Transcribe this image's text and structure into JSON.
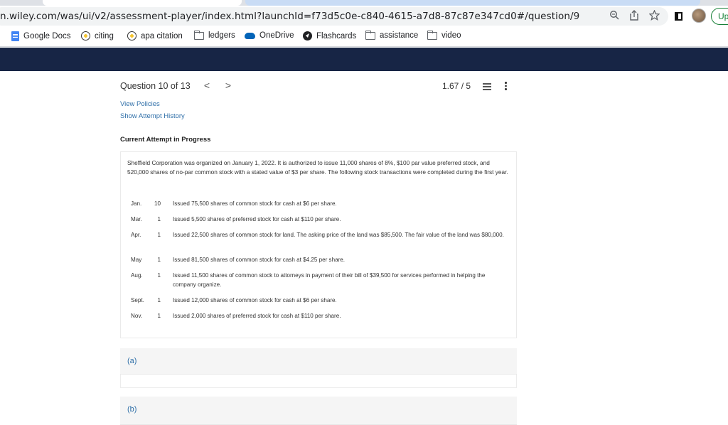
{
  "browser": {
    "url": "n.wiley.com/was/ui/v2/assessment-player/index.html?launchId=f73d5c0e-c840-4615-a7d8-87c87e347cd0#/question/9",
    "update_label": "Up",
    "bookmarks": [
      {
        "label": "Google Docs",
        "icon": "google-docs-icon"
      },
      {
        "label": "citing",
        "icon": "globe-icon"
      },
      {
        "label": "apa citation",
        "icon": "globe-icon"
      },
      {
        "label": "ledgers",
        "icon": "folder-icon"
      },
      {
        "label": "OneDrive",
        "icon": "cloud-icon"
      },
      {
        "label": "Flashcards",
        "icon": "flashcards-icon"
      },
      {
        "label": "assistance",
        "icon": "folder-icon"
      },
      {
        "label": "video",
        "icon": "folder-icon"
      }
    ]
  },
  "header": {
    "question_label": "Question 10 of 13",
    "prev_arrow": "<",
    "next_arrow": ">",
    "score": "1.67 / 5"
  },
  "links": {
    "view_policies": "View Policies",
    "attempt_history": "Show Attempt History"
  },
  "section_title": "Current Attempt in Progress",
  "problem": {
    "intro": "Sheffield Corporation was organized on January 1, 2022. It is authorized to issue 11,000 shares of 8%, $100 par value preferred stock, and 520,000 shares of no-par common stock with a stated value of $3 per share. The following stock transactions were completed during the first year.",
    "transactions": [
      {
        "month": "Jan.",
        "day": "10",
        "desc": "Issued 75,500 shares of common stock for cash at $6 per share."
      },
      {
        "month": "Mar.",
        "day": "1",
        "desc": "Issued 5,500 shares of preferred stock for cash at $110 per share."
      },
      {
        "month": "Apr.",
        "day": "1",
        "desc": "Issued 22,500 shares of common stock for land. The asking price of the land was $85,500. The fair value of the land was $80,000."
      },
      {
        "month": "May",
        "day": "1",
        "desc": "Issued 81,500 shares of common stock for cash at $4.25 per share."
      },
      {
        "month": "Aug.",
        "day": "1",
        "desc": "Issued 11,500 shares of common stock to attorneys in payment of their bill of $39,500 for services performed in helping the company organize."
      },
      {
        "month": "Sept.",
        "day": "1",
        "desc": "Issued 12,000 shares of common stock for cash at $6 per share."
      },
      {
        "month": "Nov.",
        "day": "1",
        "desc": "Issued 2,000 shares of preferred stock for cash at $110 per share."
      }
    ]
  },
  "parts": [
    {
      "label": "(a)"
    },
    {
      "label": "(b)"
    }
  ],
  "colors": {
    "nav_band": "#172545",
    "link": "#2f6fa8"
  }
}
